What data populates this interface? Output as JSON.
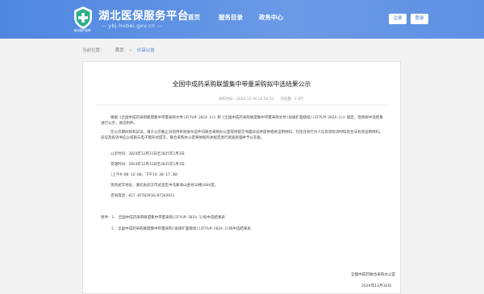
{
  "header": {
    "site_title": "湖北医保服务平台",
    "site_url": "— ybj.hubei.gov.cn —",
    "logo_caption": "湖北医疗保障",
    "nav": [
      "首页",
      "服务目录",
      "政务中心"
    ],
    "register_label": "注册",
    "login_label": "登录"
  },
  "breadcrumb": {
    "prefix": "当前位置：",
    "home": "首页",
    "sep": ">",
    "current": "价采公告"
  },
  "article": {
    "title": "全国中成药采购联盟集中带量采购拟中选结果公示",
    "published": "发布时间：2024-12-30 23:50:51",
    "views": "浏览量：1.8万",
    "para1": "根据《全国中成药采购联盟集中带量采购文件(ZCYLM-2024-1)》和《全国中成药采购联盟集中带量采购文件(省级扩面接续)(ZCYLM-2024-2)》规定，现将拟中选结果进行公示，请见附件。",
    "para2": "在公示期间如有异议，请于公示截止日前持有效身份证件向联合采购办公室现场提交书面异议并提供相关证明材料，包括违背行为人信息等投诉材料及合法有效证明材料。异议及投诉书应以纸质与电子版形式提交，联合采购办公室将依据有关规定进行调查处理并予以答复。",
    "publicity_period": "公示时间：2024年12月31日至2025年1月3日",
    "accept_period": "受理时间：2024年12月31日至2025年1月3日",
    "accept_hours": "（上午9:00-12:00，下午14:30-17:30）",
    "address": "现场递交地址：湖北省武汉市武昌区中北路海山金谷16楼1604室。",
    "phone": "咨询电话：027-87263910/87263911",
    "attachment_prefix": "附件：",
    "attachments": [
      "1. 全国中成药采购联盟集中带量采购(ZCYLM-2024-1)拟中选结果表",
      "2. 全国中成药采购联盟集中带量采购(省级扩面接续)(ZCYLM-2024-2)拟中选结果表"
    ],
    "signature_org": "全国中成药联合采购办公室",
    "signature_date": "2024年12月30日"
  },
  "colors": {
    "header_blue": "#5c8ee0",
    "link_blue": "#3d7ad8"
  }
}
